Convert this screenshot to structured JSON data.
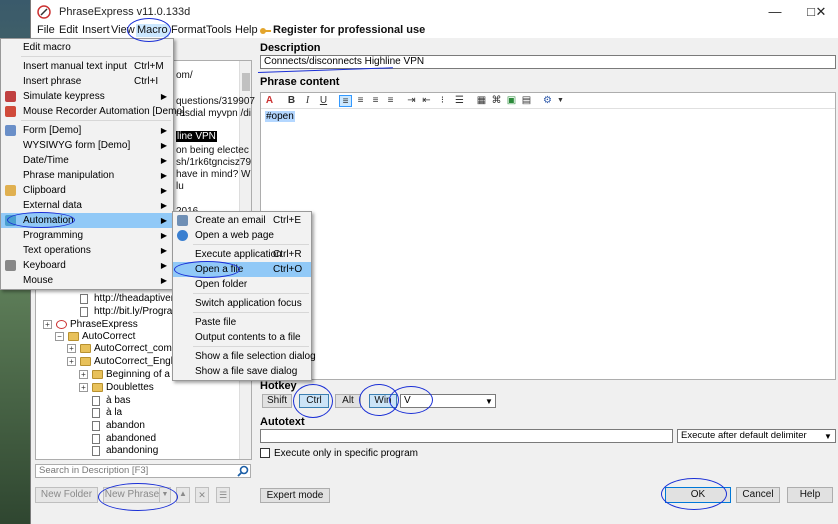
{
  "window": {
    "title": "PhraseExpress v11.0.133d",
    "minimize": "—",
    "maximize": "□",
    "close": "✕"
  },
  "menubar": [
    "File",
    "Edit",
    "Insert",
    "View",
    "Macro",
    "Format",
    "Tools",
    "Help"
  ],
  "register_link": "Register for professional use",
  "macro_menu": [
    {
      "label": "Edit macro",
      "shortcut": "",
      "submenu": false
    },
    {
      "label": "Insert manual text input",
      "shortcut": "Ctrl+M",
      "submenu": false
    },
    {
      "label": "Insert phrase",
      "shortcut": "Ctrl+I",
      "submenu": false
    },
    {
      "label": "Simulate keypress",
      "shortcut": "",
      "submenu": true
    },
    {
      "label": "Mouse Recorder Automation [Demo]",
      "shortcut": "",
      "submenu": false
    },
    {
      "label": "Form [Demo]",
      "shortcut": "",
      "submenu": true
    },
    {
      "label": "WYSIWYG form [Demo]",
      "shortcut": "",
      "submenu": true
    },
    {
      "label": "Date/Time",
      "shortcut": "",
      "submenu": true
    },
    {
      "label": "Phrase manipulation",
      "shortcut": "",
      "submenu": true
    },
    {
      "label": "Clipboard",
      "shortcut": "",
      "submenu": true
    },
    {
      "label": "External data",
      "shortcut": "",
      "submenu": true
    },
    {
      "label": "Automation",
      "shortcut": "",
      "submenu": true
    },
    {
      "label": "Programming",
      "shortcut": "",
      "submenu": true
    },
    {
      "label": "Text operations",
      "shortcut": "",
      "submenu": true
    },
    {
      "label": "Keyboard",
      "shortcut": "",
      "submenu": true
    },
    {
      "label": "Mouse",
      "shortcut": "",
      "submenu": true
    }
  ],
  "automation_menu": [
    {
      "label": "Create an email",
      "shortcut": "Ctrl+E"
    },
    {
      "label": "Open a web page",
      "shortcut": ""
    },
    {
      "label": "Execute application",
      "shortcut": "Ctrl+R"
    },
    {
      "label": "Open a file",
      "shortcut": "Ctrl+O"
    },
    {
      "label": "Open folder",
      "shortcut": ""
    },
    {
      "label": "Switch application focus",
      "shortcut": ""
    },
    {
      "label": "Paste file",
      "shortcut": ""
    },
    {
      "label": "Output contents to a file",
      "shortcut": ""
    },
    {
      "label": "Show a file selection dialog",
      "shortcut": ""
    },
    {
      "label": "Show a file save dialog",
      "shortcut": ""
    }
  ],
  "tree_fragments": [
    "om/",
    "questions/319907",
    "rasdial myvpn /di",
    "line VPN",
    "on being electec",
    "sh/1rk6tgncisz79",
    "have in mind? W",
    "lu",
    "2016"
  ],
  "tree_items": [
    {
      "label": "http://theadaptivemarketer",
      "icon": "doc",
      "indent": 2
    },
    {
      "label": "http://bit.ly/ProgramChairs",
      "icon": "doc",
      "indent": 2
    },
    {
      "label": "PhraseExpress",
      "icon": "app",
      "indent": 0
    },
    {
      "label": "AutoCorrect",
      "icon": "folder",
      "indent": 1
    },
    {
      "label": "AutoCorrect_common",
      "icon": "folder",
      "indent": 2
    },
    {
      "label": "AutoCorrect_English",
      "icon": "folder",
      "indent": 2
    },
    {
      "label": "Beginning of a wo",
      "icon": "folder",
      "indent": 3
    },
    {
      "label": "Doublettes",
      "icon": "folder",
      "indent": 3
    },
    {
      "label": "à bas",
      "icon": "doc",
      "indent": 3
    },
    {
      "label": "à la",
      "icon": "doc",
      "indent": 3
    },
    {
      "label": "abandon",
      "icon": "doc",
      "indent": 3
    },
    {
      "label": "abandoned",
      "icon": "doc",
      "indent": 3
    },
    {
      "label": "abandoning",
      "icon": "doc",
      "indent": 3
    }
  ],
  "search_placeholder": "Search in Description [F3]",
  "bottom_left_buttons": {
    "new_folder": "New Folder",
    "new_phrase": "New Phrase"
  },
  "description": {
    "label": "Description",
    "value": "Connects/disconnects Highline VPN"
  },
  "phrase_content": {
    "label": "Phrase content",
    "value": "#open"
  },
  "hotkey": {
    "label": "Hotkey",
    "shift": "Shift",
    "ctrl": "Ctrl",
    "alt": "Alt",
    "win": "Win",
    "key": "V"
  },
  "autotext": {
    "label": "Autotext",
    "value": "",
    "mode": "Execute after default delimiter"
  },
  "execute_only": "Execute only in specific program",
  "footer": {
    "expert": "Expert mode",
    "ok": "OK",
    "cancel": "Cancel",
    "help": "Help"
  },
  "colors": {
    "annotation": "#1a2fd6",
    "highlight": "#91c9f7",
    "accent": "#3399ff"
  }
}
